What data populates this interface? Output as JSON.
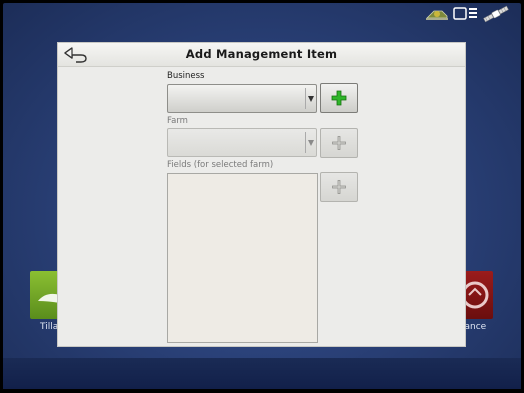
{
  "dialog": {
    "title": "Add Management Item",
    "back_icon": "back-arrow-icon"
  },
  "business": {
    "label": "Business",
    "value": "",
    "add_icon": "green-plus-icon",
    "add_color": "#2fb52a",
    "enabled": true
  },
  "farm": {
    "label": "Farm",
    "value": "",
    "add_icon": "plus-icon",
    "enabled": false
  },
  "fields": {
    "label": "Fields (for selected farm)",
    "items": [],
    "add_icon": "plus-icon",
    "enabled": false
  },
  "background": {
    "tile_left_label": "Tilla",
    "tile_right_label": "lance",
    "status_icons": [
      "gps-receiver-icon",
      "display-screen-icon",
      "satellite-icon"
    ]
  }
}
